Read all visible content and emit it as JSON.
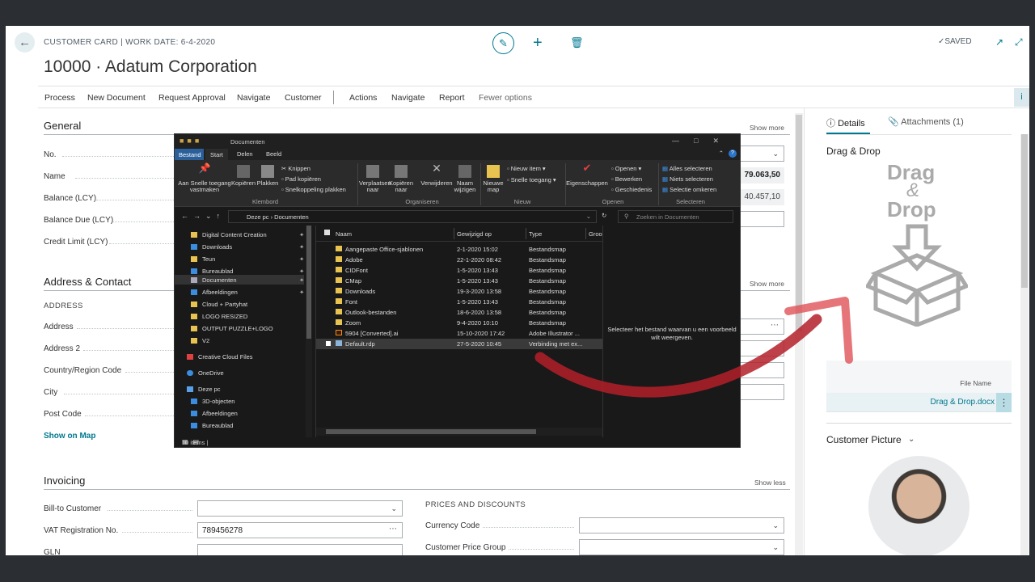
{
  "header": {
    "breadcrumb": "CUSTOMER CARD | WORK DATE: 6-4-2020",
    "title": "10000 · Adatum Corporation",
    "saved": "SAVED",
    "icons": {
      "back": "back-arrow-icon",
      "edit": "pencil-icon",
      "add": "plus-icon",
      "delete": "trash-icon",
      "open": "open-new-window-icon",
      "collapse": "collapse-icon"
    }
  },
  "actions": {
    "items": [
      "Process",
      "New Document",
      "Request Approval",
      "Navigate",
      "Customer",
      "Actions",
      "Navigate",
      "Report",
      "Fewer options"
    ],
    "info": "i"
  },
  "general": {
    "title": "General",
    "show": "Show more",
    "fields": [
      {
        "label": "No.",
        "value": ""
      },
      {
        "label": "Name",
        "value": "79.063,50"
      },
      {
        "label": "Balance (LCY)",
        "value": "40.457,10"
      },
      {
        "label": "Balance Due (LCY)",
        "value": ""
      },
      {
        "label": "Credit Limit (LCY)",
        "value": ""
      }
    ]
  },
  "address": {
    "title": "Address & Contact",
    "show": "Show more",
    "group": "ADDRESS",
    "fields": [
      "Address",
      "Address 2",
      "Country/Region Code",
      "City",
      "Post Code"
    ],
    "show_on_map": "Show on Map"
  },
  "invoicing": {
    "title": "Invoicing",
    "show": "Show less",
    "fields": [
      {
        "label": "Bill-to Customer",
        "value": ""
      },
      {
        "label": "VAT Registration No.",
        "value": "789456278"
      },
      {
        "label": "GLN",
        "value": ""
      }
    ],
    "prices_group": "PRICES AND DISCOUNTS",
    "prices_fields": [
      "Currency Code",
      "Customer Price Group"
    ]
  },
  "factbox": {
    "tab_details": "Details",
    "tab_attachments": "Attachments (1)",
    "dd_title": "Drag & Drop",
    "dd_art": {
      "word1": "Drag",
      "amp": "&",
      "word2": "Drop"
    },
    "file_name_header": "File Name",
    "file_name": "Drag & Drop.docx",
    "more": "⋮",
    "customer_picture": "Customer Picture"
  },
  "explorer": {
    "title": "Documenten",
    "tabs": [
      "Bestand",
      "Start",
      "Delen",
      "Beeld"
    ],
    "ribbon": {
      "pin": "Aan Snelle toegang vastmaken",
      "copy": "Kopiëren",
      "paste": "Plakken",
      "cut": "Knippen",
      "copy_path": "Pad kopiëren",
      "paste_shortcut": "Snelkoppeling plakken",
      "group_clipboard": "Klembord",
      "move": "Verplaatsen naar",
      "copy_to": "Kopiëren naar",
      "delete": "Verwijderen",
      "rename": "Naam wijzigen",
      "group_organize": "Organiseren",
      "new_folder": "Nieuwe map",
      "new_item": "Nieuw item",
      "easy_access": "Snelle toegang",
      "group_new": "Nieuw",
      "properties": "Eigenschappen",
      "open": "Openen",
      "edit": "Bewerken",
      "history": "Geschiedenis",
      "group_open": "Openen",
      "select_all": "Alles selecteren",
      "select_none": "Niets selecteren",
      "invert": "Selectie omkeren",
      "group_select": "Selecteren"
    },
    "address": "Deze pc  ›  Documenten",
    "search_placeholder": "Zoeken in Documenten",
    "tree": [
      "Digital Content Creation",
      "Downloads",
      "Teun",
      "Bureaublad",
      "Documenten",
      "Afbeeldingen",
      "Cloud + Partyhat",
      "LOGO RESIZED",
      "OUTPUT PUZZLE+LOGO",
      "V2",
      "Creative Cloud Files",
      "OneDrive",
      "Deze pc",
      "3D-objecten",
      "Afbeeldingen",
      "Bureaublad"
    ],
    "columns": [
      "Naam",
      "Gewijzigd op",
      "Type",
      "Groo"
    ],
    "files": [
      {
        "name": "Aangepaste Office-sjablonen",
        "date": "2-1-2020 15:02",
        "type": "Bestandsmap"
      },
      {
        "name": "Adobe",
        "date": "22-1-2020 08:42",
        "type": "Bestandsmap"
      },
      {
        "name": "CIDFont",
        "date": "1-5-2020 13:43",
        "type": "Bestandsmap"
      },
      {
        "name": "CMap",
        "date": "1-5-2020 13:43",
        "type": "Bestandsmap"
      },
      {
        "name": "Downloads",
        "date": "19-3-2020 13:58",
        "type": "Bestandsmap"
      },
      {
        "name": "Font",
        "date": "1-5-2020 13:43",
        "type": "Bestandsmap"
      },
      {
        "name": "Outlook-bestanden",
        "date": "18-6-2020 13:58",
        "type": "Bestandsmap"
      },
      {
        "name": "Zoom",
        "date": "9-4-2020 10:10",
        "type": "Bestandsmap"
      },
      {
        "name": "5904 [Converted].ai",
        "date": "15-10-2020 17:42",
        "type": "Adobe Illustrator ..."
      },
      {
        "name": "Default.rdp",
        "date": "27-5-2020 10:45",
        "type": "Verbinding met ex..."
      }
    ],
    "preview": "Selecteer het bestand waarvan u een voorbeeld wilt weergeven.",
    "status": "10 items  |"
  },
  "colors": {
    "accent": "#00788f",
    "arrow": "#b3202a"
  }
}
